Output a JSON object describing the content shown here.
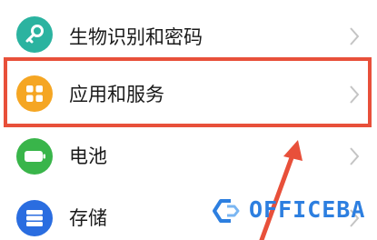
{
  "settings_list": {
    "items": [
      {
        "id": "biometrics",
        "label": "生物识别和密码",
        "icon": "key-icon",
        "color": "#2bb3a0"
      },
      {
        "id": "apps",
        "label": "应用和服务",
        "icon": "apps-grid-icon",
        "color": "#f5a623"
      },
      {
        "id": "battery",
        "label": "电池",
        "icon": "battery-icon",
        "color": "#39b54a"
      },
      {
        "id": "storage",
        "label": "存储",
        "icon": "storage-icon",
        "color": "#2a6de0"
      }
    ]
  },
  "annotation": {
    "highlight_color": "#e8503a",
    "highlighted_item": "apps"
  },
  "watermark": {
    "text": "OFFICEBA",
    "color": "#2d7fe0"
  }
}
